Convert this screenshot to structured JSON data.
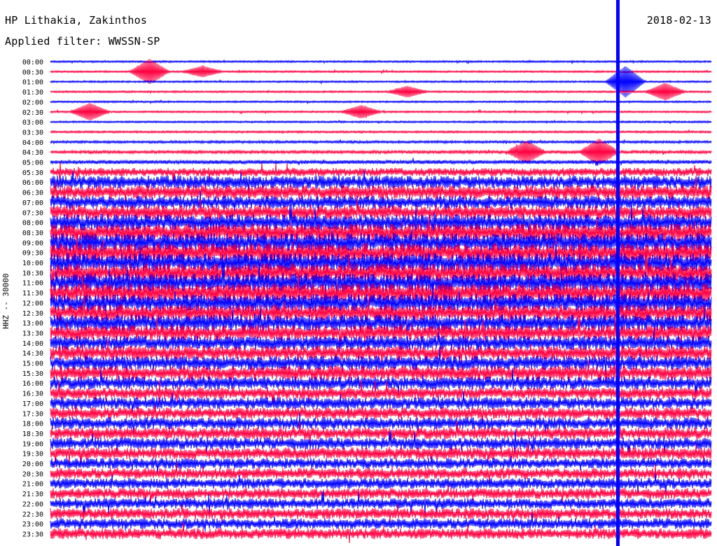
{
  "header": {
    "station": "HP Lithakia, Zakinthos",
    "date": "2018-02-13",
    "filter": "Applied filter: WWSSN-SP"
  },
  "channel_label": "HHZ -- 30000",
  "chart_data": {
    "type": "line",
    "title": "HP Lithakia, Zakinthos",
    "subtitle": "Applied filter: WWSSN-SP",
    "date": "2018-02-13",
    "ylabel": "HHZ -- 30000",
    "rows": [
      "00:00",
      "00:30",
      "01:00",
      "01:30",
      "02:00",
      "02:30",
      "03:00",
      "03:30",
      "04:00",
      "04:30",
      "05:00",
      "05:30",
      "06:00",
      "06:30",
      "07:00",
      "07:30",
      "08:00",
      "08:30",
      "09:00",
      "09:30",
      "10:00",
      "10:30",
      "11:00",
      "11:30",
      "12:00",
      "12:30",
      "13:00",
      "13:30",
      "14:00",
      "14:30",
      "15:00",
      "15:30",
      "16:00",
      "16:30",
      "17:00",
      "17:30",
      "18:00",
      "18:30",
      "19:00",
      "19:30",
      "20:00",
      "20:30",
      "21:00",
      "21:30",
      "22:00",
      "22:30",
      "23:00",
      "23:30"
    ],
    "colors": [
      "#0000ff",
      "#ff0040"
    ],
    "row_amplitude": [
      0.05,
      0.05,
      0.05,
      0.05,
      0.05,
      0.05,
      0.05,
      0.06,
      0.08,
      0.1,
      0.14,
      0.35,
      0.55,
      0.6,
      0.55,
      0.6,
      0.7,
      0.75,
      0.8,
      0.8,
      0.8,
      0.8,
      0.8,
      0.8,
      0.75,
      0.7,
      0.7,
      0.65,
      0.6,
      0.6,
      0.6,
      0.6,
      0.55,
      0.5,
      0.5,
      0.5,
      0.5,
      0.5,
      0.5,
      0.5,
      0.45,
      0.45,
      0.45,
      0.45,
      0.45,
      0.45,
      0.45,
      0.45
    ],
    "events": [
      {
        "row": 1,
        "x": 0.15,
        "amp": 1.2
      },
      {
        "row": 1,
        "x": 0.23,
        "amp": 0.5
      },
      {
        "row": 5,
        "x": 0.06,
        "amp": 0.8
      },
      {
        "row": 5,
        "x": 0.47,
        "amp": 0.6
      },
      {
        "row": 3,
        "x": 0.54,
        "amp": 0.5
      },
      {
        "row": 9,
        "x": 0.72,
        "amp": 1.0
      },
      {
        "row": 9,
        "x": 0.83,
        "amp": 1.2
      },
      {
        "row": 2,
        "x": 0.87,
        "amp": 1.5
      },
      {
        "row": 3,
        "x": 0.93,
        "amp": 0.8
      }
    ],
    "spike_x": 0.858
  }
}
